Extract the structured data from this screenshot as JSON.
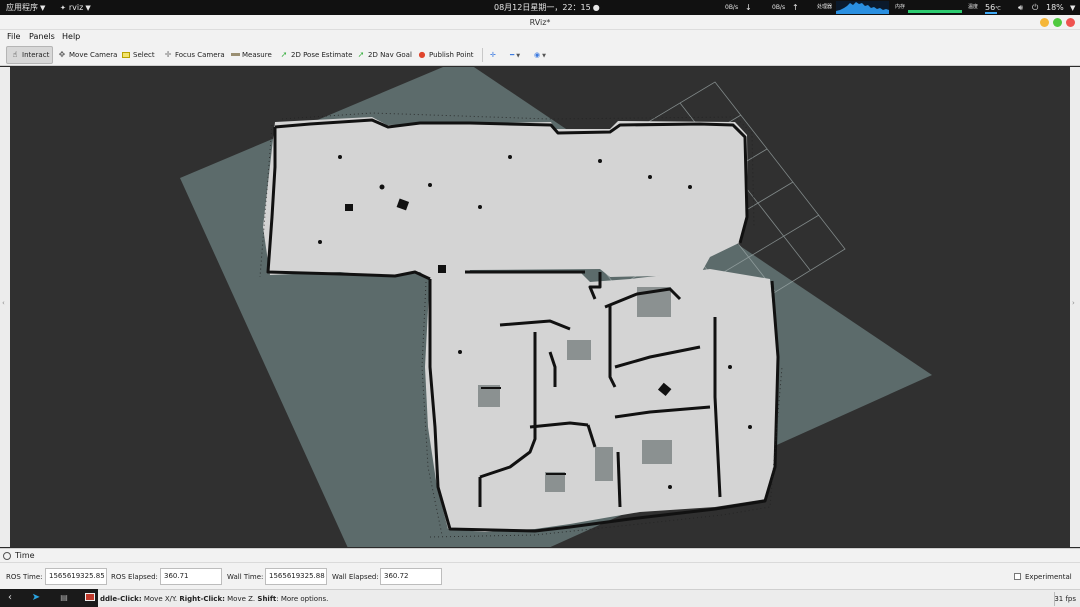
{
  "topbar": {
    "apps_label": "应用程序",
    "app_name": "rviz",
    "datetime": "08月12日星期一，22：15",
    "net_down": "0B/s",
    "net_up": "0B/s",
    "cpu_label": "处理器",
    "mem_label": "内存",
    "temp_label": "温度",
    "temp_value": "56",
    "temp_unit": "℃",
    "battery": "18%",
    "colors": {
      "bar_bg": "#111111",
      "cpu_graph": "#2a8fe0",
      "mem": "#2ecc71"
    }
  },
  "window": {
    "title": "RViz*",
    "buttons": [
      "minimize",
      "maximize",
      "close"
    ],
    "colors": {
      "minimize": "#f5b638",
      "maximize": "#4fc93f",
      "close": "#ef5350"
    }
  },
  "menubar": {
    "items": [
      "File",
      "Panels",
      "Help"
    ]
  },
  "toolbar": {
    "tools": [
      {
        "label": "Interact",
        "icon": "cursor-icon",
        "active": true
      },
      {
        "label": "Move Camera",
        "icon": "move-camera-icon",
        "active": false
      },
      {
        "label": "Select",
        "icon": "select-icon",
        "active": false
      },
      {
        "label": "Focus Camera",
        "icon": "focus-camera-icon",
        "active": false
      },
      {
        "label": "Measure",
        "icon": "ruler-icon",
        "active": false
      },
      {
        "label": "2D Pose Estimate",
        "icon": "pose-arrow-icon",
        "active": false
      },
      {
        "label": "2D Nav Goal",
        "icon": "nav-arrow-icon",
        "active": false
      },
      {
        "label": "Publish Point",
        "icon": "map-pin-icon",
        "active": false
      }
    ],
    "extras": [
      "add-tool-icon",
      "remove-tool-icon",
      "view-options-icon"
    ]
  },
  "viewport": {
    "background": "#303030",
    "plane_color": "#5c6b6b",
    "free_space_color": "#d4d4d4",
    "wall_color": "#111111",
    "grid_color": "#a3aeae"
  },
  "time_panel": {
    "title": "Time",
    "ros_time_label": "ROS Time:",
    "ros_time": "1565619325.85",
    "ros_elapsed_label": "ROS Elapsed:",
    "ros_elapsed": "360.71",
    "wall_time_label": "Wall Time:",
    "wall_time": "1565619325.88",
    "wall_elapsed_label": "Wall Elapsed:",
    "wall_elapsed": "360.72",
    "experimental_label": "Experimental",
    "experimental_checked": false
  },
  "statusbar": {
    "middle_click_label": "ddle-Click:",
    "middle_click_text": "Move X/Y.",
    "right_click_label": "Right-Click:",
    "right_click_text": "Move Z.",
    "shift_label": "Shift",
    "shift_text": ": More options.",
    "fps": "31 fps"
  },
  "taskbar": {
    "icons": [
      "back-arrow-icon",
      "telegram-icon",
      "files-icon",
      "terminal-icon"
    ]
  }
}
